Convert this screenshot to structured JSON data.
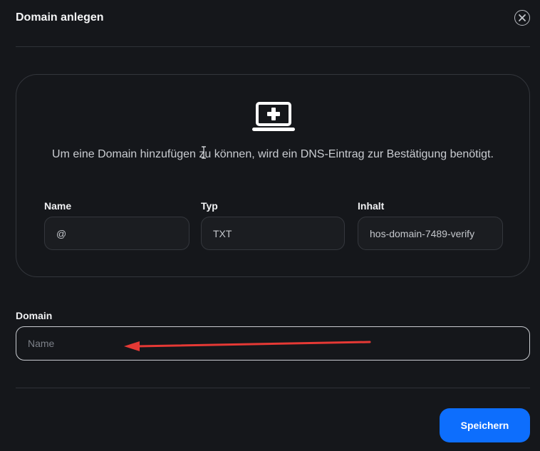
{
  "modal": {
    "title": "Domain anlegen"
  },
  "icons": {
    "close": "close-circle-icon",
    "card": "laptop-plus-icon",
    "cursor": "text-cursor-icon",
    "annotation": "red-arrow-annotation"
  },
  "dns_card": {
    "info_text": "Um eine Domain hinzufügen zu können, wird ein DNS-Eintrag zur Bestätigung benötigt.",
    "fields": [
      {
        "label": "Name",
        "value": "@"
      },
      {
        "label": "Typ",
        "value": "TXT"
      },
      {
        "label": "Inhalt",
        "value": "hos-domain-7489-verify"
      }
    ]
  },
  "domain_field": {
    "label": "Domain",
    "placeholder": "Name",
    "value": ""
  },
  "actions": {
    "save_label": "Speichern"
  },
  "colors": {
    "background": "#15171b",
    "accent": "#0d6efd",
    "annotation": "#e53935"
  }
}
